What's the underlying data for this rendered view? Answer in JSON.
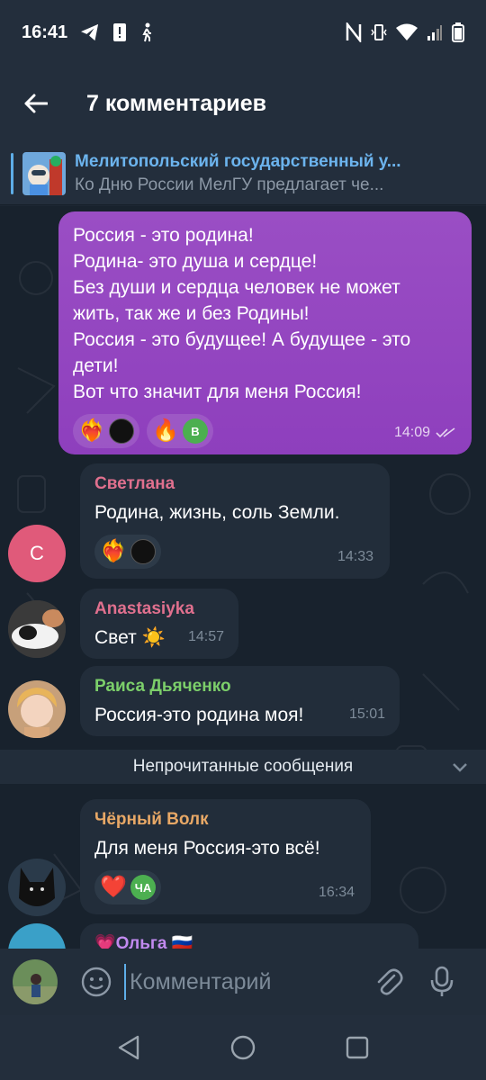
{
  "status_bar": {
    "time": "16:41",
    "left_icons": [
      "telegram-icon",
      "alert-icon",
      "walking-icon"
    ],
    "right_icons": [
      "nfc-icon",
      "vibrate-icon",
      "wifi-icon",
      "signal-icon",
      "battery-icon"
    ]
  },
  "header": {
    "title": "7 комментариев",
    "back_icon": "arrow-left-icon"
  },
  "pinned": {
    "title": "Мелитопольский государственный у...",
    "subtitle": "Ко Дню России МелГУ предлагает че..."
  },
  "messages": [
    {
      "type": "outgoing",
      "lines": [
        "Россия - это родина!",
        "Родина- это душа и сердце!",
        "Без души и сердца человек не может",
        "жить, так же и без Родины!",
        "Россия - это будущее! А будущее - это",
        "дети!",
        "Вот что значит для меня Россия!"
      ],
      "time": "14:09",
      "reactions": [
        {
          "emoji": "❤️‍🔥",
          "avatar_letter": ""
        },
        {
          "emoji": "🔥",
          "avatar_letter": "В"
        }
      ]
    },
    {
      "type": "incoming",
      "sender": "Светлана",
      "sender_color": "#e0708e",
      "avatar_letter": "С",
      "text": "Родина, жизнь, соль Земли.",
      "time": "14:33",
      "reactions": [
        {
          "emoji": "❤️‍🔥",
          "avatar_letter": ""
        }
      ]
    },
    {
      "type": "incoming",
      "sender": "Anastasiyka",
      "sender_color": "#e0708e",
      "text": "Свет ☀️",
      "time": "14:57"
    },
    {
      "type": "incoming",
      "sender": "Раиса Дьяченко",
      "sender_color": "#7ccf6a",
      "text": "Россия-это родина моя!",
      "time": "15:01"
    },
    {
      "type": "incoming",
      "sender": "Чёрный Волк",
      "sender_color": "#e8a866",
      "text": "Для меня Россия-это всё!",
      "time": "16:34",
      "reactions": [
        {
          "emoji": "❤️",
          "avatar_letter": "ЧА"
        }
      ]
    },
    {
      "type": "incoming",
      "sender": "💗Ольга 🇷🇺",
      "sender_color": "#c28af0"
    }
  ],
  "unread_label": "Непрочитанные сообщения",
  "composer": {
    "placeholder": "Комментарий"
  },
  "nav": [
    "back-triangle-icon",
    "home-circle-icon",
    "recents-square-icon"
  ]
}
